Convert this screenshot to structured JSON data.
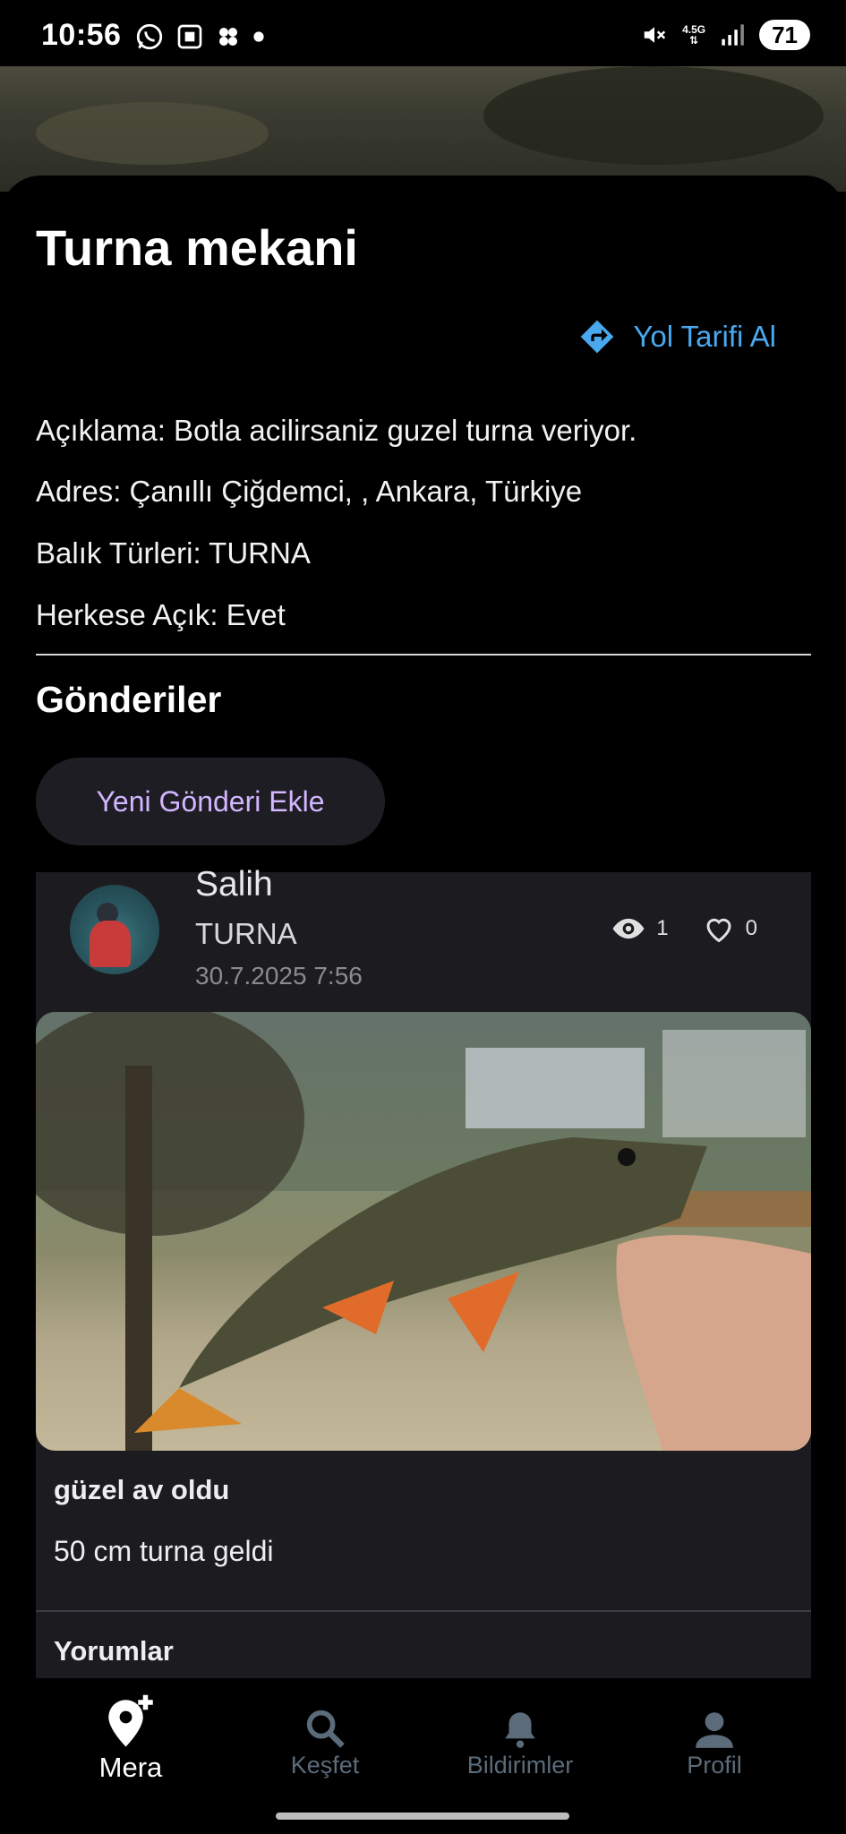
{
  "status_bar": {
    "time": "10:56",
    "network": "4.5G",
    "battery": "71"
  },
  "place": {
    "title": "Turna mekani",
    "route_label": "Yol Tarifi Al",
    "description": "Açıklama: Botla acilirsaniz guzel turna veriyor.",
    "address": "Adres: Çanıllı Çiğdemci, , Ankara, Türkiye",
    "fish_types": "Balık Türleri: TURNA",
    "public": "Herkese Açık: Evet"
  },
  "posts_section": {
    "title": "Gönderiler",
    "add_button": "Yeni Gönderi Ekle"
  },
  "post": {
    "user": "Salih",
    "fish": "TURNA",
    "date": "30.7.2025 7:56",
    "views": "1",
    "likes": "0",
    "title": "güzel av oldu",
    "body": "50 cm turna geldi",
    "comments_label": "Yorumlar"
  },
  "bottom_nav": [
    {
      "label": "Mera",
      "icon": "add-location-icon",
      "active": true
    },
    {
      "label": "Keşfet",
      "icon": "search-icon",
      "active": false
    },
    {
      "label": "Bildirimler",
      "icon": "bell-icon",
      "active": false
    },
    {
      "label": "Profil",
      "icon": "person-icon",
      "active": false
    }
  ],
  "colors": {
    "accent_blue": "#4aa8ef",
    "button_text": "#d2b6ff",
    "nav_inactive": "#5b6b7a"
  }
}
